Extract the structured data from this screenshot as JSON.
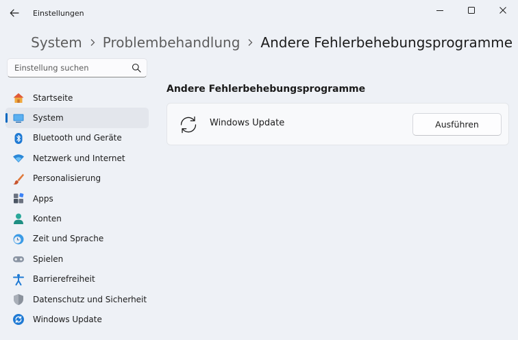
{
  "window": {
    "title": "Einstellungen",
    "controls": [
      "minimize-icon",
      "maximize-icon",
      "close-icon"
    ]
  },
  "breadcrumb": {
    "items": [
      "System",
      "Problembehandlung",
      "Andere Fehlerbehebungsprogramme"
    ],
    "separator_icon": "chevron-right-icon"
  },
  "search": {
    "placeholder": "Einstellung suchen",
    "value": "",
    "icon": "search-icon"
  },
  "sidebar": {
    "active_index": 1,
    "items": [
      {
        "label": "Startseite",
        "icon": "home-icon"
      },
      {
        "label": "System",
        "icon": "monitor-icon"
      },
      {
        "label": "Bluetooth und Geräte",
        "icon": "bluetooth-icon"
      },
      {
        "label": "Netzwerk und Internet",
        "icon": "wifi-icon"
      },
      {
        "label": "Personalisierung",
        "icon": "brush-icon"
      },
      {
        "label": "Apps",
        "icon": "apps-icon"
      },
      {
        "label": "Konten",
        "icon": "person-icon"
      },
      {
        "label": "Zeit und Sprache",
        "icon": "globe-clock-icon"
      },
      {
        "label": "Spielen",
        "icon": "gamepad-icon"
      },
      {
        "label": "Barrierefreiheit",
        "icon": "accessibility-icon"
      },
      {
        "label": "Datenschutz und Sicherheit",
        "icon": "shield-icon"
      },
      {
        "label": "Windows Update",
        "icon": "windows-update-icon"
      }
    ]
  },
  "main": {
    "section_title": "Andere Fehlerbehebungsprogramme",
    "troubleshooters": [
      {
        "label": "Windows Update",
        "icon": "refresh-icon",
        "button_label": "Ausführen"
      }
    ]
  },
  "colors": {
    "background": "#eef1f6",
    "accent": "#0067c0",
    "card": "#f8f9fb",
    "nav_active": "#e3e6ec"
  }
}
